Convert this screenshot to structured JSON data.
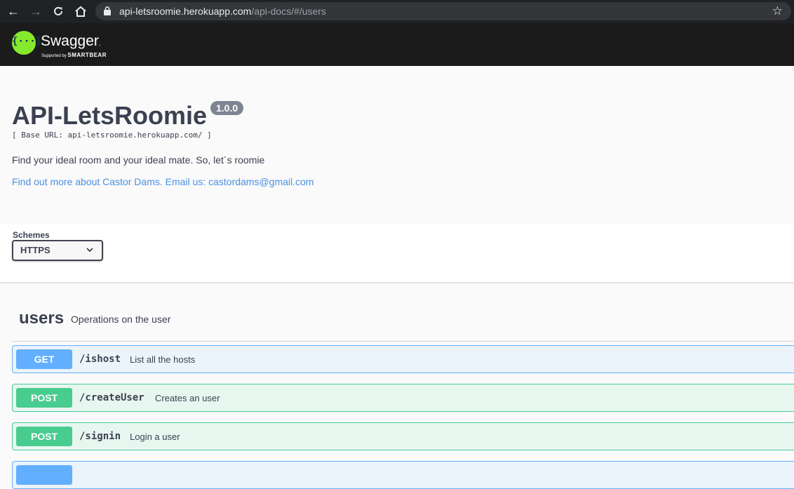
{
  "browser": {
    "url_host": "api-letsroomie.herokuapp.com",
    "url_path": "/api-docs/#/users",
    "back_icon": "back-arrow-icon",
    "forward_icon": "forward-arrow-icon",
    "reload_icon": "reload-icon",
    "home_icon": "home-icon",
    "bookmark_icon": "star-icon"
  },
  "topbar": {
    "brand_name": "Swagger",
    "brand_tm": ".",
    "supported_by": "Supported by",
    "smartbear": "SMARTBEAR",
    "logo_glyph": "{···}"
  },
  "info": {
    "title": "API-LetsRoomie",
    "version": "1.0.0",
    "base_url": "[ Base URL: api-letsroomie.herokuapp.com/ ]",
    "description": "Find your ideal room and your ideal mate. So, let´s roomie",
    "contact": "Find out more about Castor Dams. Email us: castordams@gmail.com"
  },
  "schemes": {
    "label": "Schemes",
    "selected": "HTTPS"
  },
  "tag": {
    "name": "users",
    "description": "Operations on the user"
  },
  "operations": [
    {
      "method": "GET",
      "path": "/ishost",
      "summary": "List all the hosts",
      "color": "#61affe"
    },
    {
      "method": "POST",
      "path": "/createUser",
      "summary": "Creates an user",
      "color": "#49cc90"
    },
    {
      "method": "POST",
      "path": "/signin",
      "summary": "Login a user",
      "color": "#49cc90"
    }
  ]
}
